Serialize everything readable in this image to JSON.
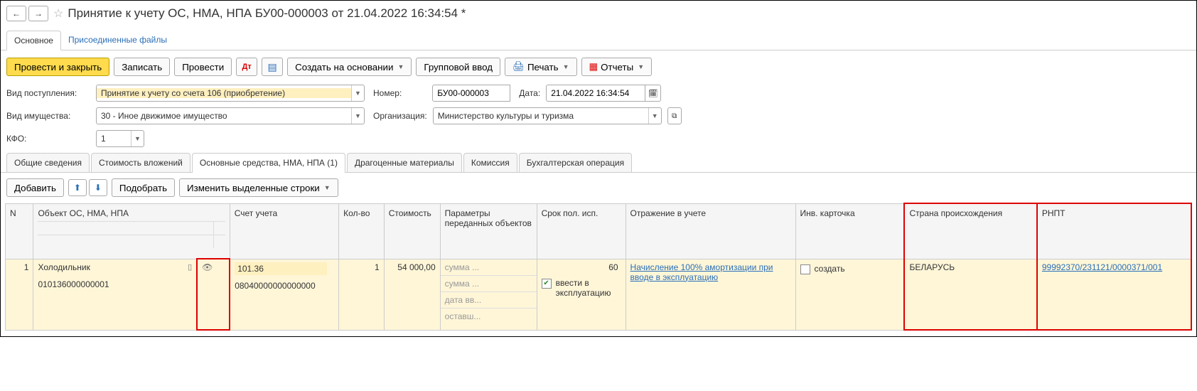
{
  "header": {
    "title": "Принятие к учету ОС, НМА, НПА БУ00-000003 от 21.04.2022 16:34:54 *"
  },
  "top_tabs": {
    "main": "Основное",
    "files": "Присоединенные файлы"
  },
  "toolbar": {
    "post_close": "Провести и закрыть",
    "save": "Записать",
    "post": "Провести",
    "create_based": "Создать на основании",
    "group_input": "Групповой ввод",
    "print": "Печать",
    "reports": "Отчеты"
  },
  "form": {
    "income_type_label": "Вид поступления:",
    "income_type_value": "Принятие к учету со счета 106 (приобретение)",
    "number_label": "Номер:",
    "number_value": "БУ00-000003",
    "date_label": "Дата:",
    "date_value": "21.04.2022 16:34:54",
    "property_type_label": "Вид имущества:",
    "property_type_value": "30 - Иное движимое имущество",
    "org_label": "Организация:",
    "org_value": "Министерство культуры и туризма",
    "kfo_label": "КФО:",
    "kfo_value": "1"
  },
  "tabs": {
    "t1": "Общие сведения",
    "t2": "Стоимость вложений",
    "t3": "Основные средства, НМА, НПА (1)",
    "t4": "Драгоценные материалы",
    "t5": "Комиссия",
    "t6": "Бухгалтерская операция"
  },
  "sub_toolbar": {
    "add": "Добавить",
    "pick": "Подобрать",
    "edit_rows": "Изменить выделенные строки"
  },
  "grid": {
    "headers": {
      "n": "N",
      "object": "Объект ОС, НМА, НПА",
      "account": "Счет учета",
      "qty": "Кол-во",
      "cost": "Стоимость",
      "params": "Параметры переданных объектов",
      "service_life": "Срок пол. исп.",
      "reflection": "Отражение в учете",
      "inv_card": "Инв. карточка",
      "country": "Страна происхождения",
      "rnpt": "РНПТ"
    },
    "row": {
      "n": "1",
      "object_name": "Холодильник",
      "object_code": "010136000000001",
      "account_code": "101.36",
      "account_sub": "08040000000000000",
      "qty": "1",
      "cost": "54 000,00",
      "param_sum1": "сумма ...",
      "param_sum2": "сумма ...",
      "param_date": "дата вв...",
      "param_rest": "оставш...",
      "service_num": "60",
      "service_label": "ввести в эксплуатацию",
      "reflection_link": "Начисление 100% амортизации при вводе в эксплуатацию",
      "inv_label": "создать",
      "country": "БЕЛАРУСЬ",
      "rnpt": "99992370/231121/0000371/001"
    }
  }
}
